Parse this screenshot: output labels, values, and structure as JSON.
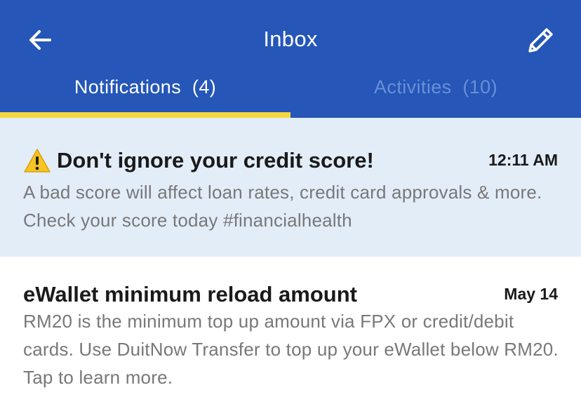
{
  "header": {
    "title": "Inbox",
    "back_icon": "arrow-left-icon",
    "edit_icon": "pencil-icon",
    "background": "#2556b8"
  },
  "tabs": [
    {
      "label": "Notifications  (4)",
      "active": true
    },
    {
      "label": "Activities  (10)",
      "active": false
    }
  ],
  "tab_indicator_color": "#f3d93c",
  "notifications": [
    {
      "icon": "warning-icon",
      "title": "Don't ignore your credit score!",
      "time": "12:11 AM",
      "body": "A bad score will affect loan rates, credit card approvals & more. Check your score today #financialhealth",
      "unread": true,
      "background": "#e2edf8"
    },
    {
      "title": "eWallet minimum reload amount",
      "time": "May 14",
      "body": "RM20 is the minimum top up amount via FPX or credit/debit cards. Use DuitNow Transfer to top up your eWallet below RM20. Tap to learn more.",
      "unread": false,
      "background": "#ffffff"
    }
  ]
}
